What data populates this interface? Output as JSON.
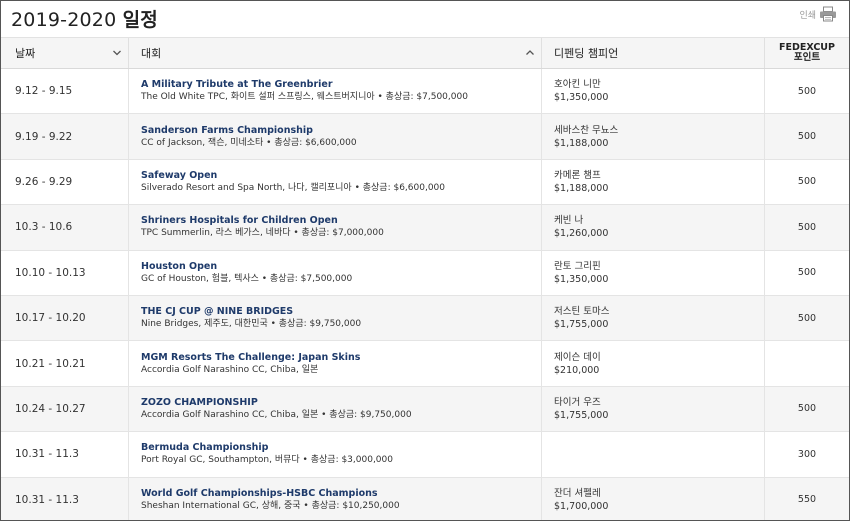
{
  "header": {
    "title_prefix": "2019-2020 ",
    "title_bold": "일정",
    "print_label": "인쇄"
  },
  "table": {
    "headers": {
      "date": "날짜",
      "event": "대회",
      "champion": "디펜딩 챔피언",
      "points_line1": "FEDEXCUP",
      "points_line2": "포인트"
    },
    "rows": [
      {
        "date": "9.12 - 9.15",
        "name": "A Military Tribute at The Greenbrier",
        "venue": "The Old White TPC,  화이트 설퍼 스프링스,  웨스트버지니아  • 총상금: $7,500,000",
        "champion": "호아킨 니만",
        "prize": "$1,350,000",
        "points": "500"
      },
      {
        "date": "9.19 - 9.22",
        "name": "Sanderson Farms Championship",
        "venue": "CC of Jackson,  잭슨,  미네소타  • 총상금: $6,600,000",
        "champion": "세바스찬 무뇨스",
        "prize": "$1,188,000",
        "points": "500"
      },
      {
        "date": "9.26 - 9.29",
        "name": "Safeway Open",
        "venue": "Silverado Resort and Spa North,  나다,  캘리포니아  • 총상금: $6,600,000",
        "champion": "카메론 챔프",
        "prize": "$1,188,000",
        "points": "500"
      },
      {
        "date": "10.3 - 10.6",
        "name": "Shriners Hospitals for Children Open",
        "venue": "TPC Summerlin,  라스 베가스,  네바다  • 총상금: $7,000,000",
        "champion": "케빈 나",
        "prize": "$1,260,000",
        "points": "500"
      },
      {
        "date": "10.10 - 10.13",
        "name": "Houston Open",
        "venue": "GC of Houston,  험블,  텍사스  • 총상금: $7,500,000",
        "champion": "란토 그리핀",
        "prize": "$1,350,000",
        "points": "500"
      },
      {
        "date": "10.17 - 10.20",
        "name": "THE CJ CUP @ NINE BRIDGES",
        "venue": "Nine Bridges,  제주도,  대한민국  • 총상금: $9,750,000",
        "champion": "저스틴 토마스",
        "prize": "$1,755,000",
        "points": "500"
      },
      {
        "date": "10.21 - 10.21",
        "name": "MGM Resorts The Challenge: Japan Skins",
        "venue": "Accordia Golf Narashino CC,  Chiba,  일본",
        "champion": "제이슨 데이",
        "prize": "$210,000",
        "points": ""
      },
      {
        "date": "10.24 - 10.27",
        "name": "ZOZO CHAMPIONSHIP",
        "venue": "Accordia Golf Narashino CC,  Chiba,  일본  • 총상금: $9,750,000",
        "champion": "타이거 우즈",
        "prize": "$1,755,000",
        "points": "500"
      },
      {
        "date": "10.31 - 11.3",
        "name": "Bermuda Championship",
        "venue": "Port Royal GC,  Southampton,  버뮤다  • 총상금: $3,000,000",
        "champion": "",
        "prize": "",
        "points": "300"
      },
      {
        "date": "10.31 - 11.3",
        "name": "World Golf Championships-HSBC Champions",
        "venue": "Sheshan International GC,  상해,  중국  • 총상금: $10,250,000",
        "champion": "잔더 셔펠레",
        "prize": "$1,700,000",
        "points": "550"
      }
    ]
  }
}
